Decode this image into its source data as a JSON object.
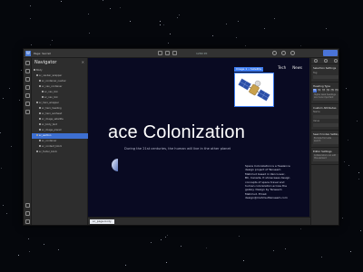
{
  "app": {
    "logo": "W",
    "project_label": "Page: Secret",
    "canvas_size": "1280 PX",
    "colors": {
      "accent": "#4a74d8",
      "selection": "#3d6fd1",
      "canvas_bg": "#090a22"
    }
  },
  "navigator": {
    "title": "Navigator",
    "close_icon": "close-icon",
    "rows": [
      {
        "label": "Body",
        "indent": 0,
        "selected": false
      },
      {
        "label": "sc_navbar_wrapper",
        "indent": 1,
        "selected": false
      },
      {
        "label": "sc_container_navbar",
        "indent": 2,
        "selected": false
      },
      {
        "label": "sc_nav_container",
        "indent": 2,
        "selected": false
      },
      {
        "label": "sc_nav_link",
        "indent": 3,
        "selected": false
      },
      {
        "label": "sc_nav_link",
        "indent": 3,
        "selected": false
      },
      {
        "label": "sc_hero_wrapper",
        "indent": 1,
        "selected": false
      },
      {
        "label": "sc_hero_heading",
        "indent": 2,
        "selected": false
      },
      {
        "label": "sc_hero_subhead",
        "indent": 2,
        "selected": false
      },
      {
        "label": "sc_image_satellite",
        "indent": 2,
        "selected": false
      },
      {
        "label": "sc_body_text",
        "indent": 2,
        "selected": false
      },
      {
        "label": "sc_image_planet",
        "indent": 2,
        "selected": false
      },
      {
        "label": "sc_section",
        "indent": 1,
        "selected": true
      },
      {
        "label": "sc_container",
        "indent": 2,
        "selected": false
      },
      {
        "label": "sc_content_block",
        "indent": 2,
        "selected": false
      },
      {
        "label": "sc_footer_block",
        "indent": 1,
        "selected": false
      }
    ]
  },
  "canvas": {
    "nav_links": [
      "Tech",
      "News"
    ],
    "hero_title": "ace Colonization",
    "hero_subtitle": "During the 21st centuries, the human will live in the other planet",
    "body_text": "Space Colonization is a freelance design project of Tanseem Mahmud based in Vancouver, BC, Canada. It showcases design concepts of space travel and human colonization across the galaxy. Design by Tanseem Mahmud. Email: design@mahmudtanseem.com",
    "image_label": "Image 1 • Satellite",
    "breadcrumb": "sc_page-body",
    "satellite_icon": "satellite-image",
    "planet_icon": "planet-image"
  },
  "right_panel": {
    "sections": [
      {
        "title": "Selection Settings",
        "lines": [
          "Tag",
          "Heading"
        ]
      },
      {
        "title": "Heading Type",
        "tags": [
          "H1",
          "H2",
          "H3",
          "H4",
          "H5",
          "H6"
        ],
        "active_tag": "H1",
        "lines": [
          "Higher level headings are more important"
        ]
      },
      {
        "title": "Custom Attributes",
        "lines": [
          "Name",
          "Value"
        ]
      },
      {
        "title": "Search Index Settings",
        "lines": [
          "Exclude from site search"
        ]
      },
      {
        "title": "Editor Settings",
        "lines": [
          "Collaborators can edit this element"
        ]
      }
    ]
  }
}
